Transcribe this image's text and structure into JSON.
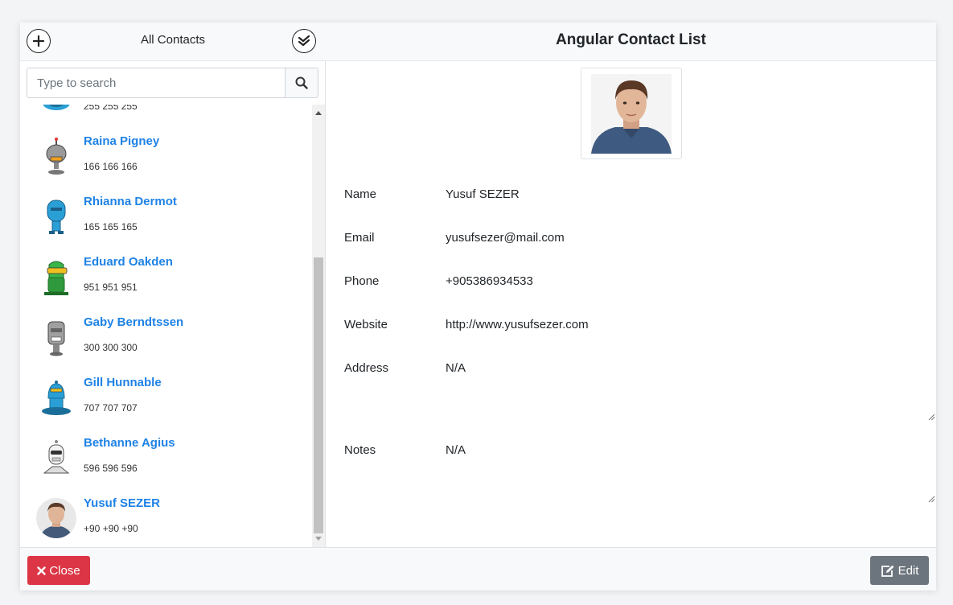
{
  "sidebar": {
    "title": "All Contacts",
    "add_icon": "plus-circle-icon",
    "check_icon": "double-check-icon",
    "search": {
      "placeholder": "Type to search",
      "value": ""
    },
    "contacts": [
      {
        "name": "",
        "phone": "255 255 255",
        "avatar": "robot-blue-round"
      },
      {
        "name": "Raina Pigney",
        "phone": "166 166 166",
        "avatar": "robot-grey-antenna"
      },
      {
        "name": "Rhianna Dermot",
        "phone": "165 165 165",
        "avatar": "robot-blue-tall"
      },
      {
        "name": "Eduard Oakden",
        "phone": "951 951 951",
        "avatar": "robot-green"
      },
      {
        "name": "Gaby Berndtssen",
        "phone": "300 300 300",
        "avatar": "robot-grey-box"
      },
      {
        "name": "Gill Hunnable",
        "phone": "707 707 707",
        "avatar": "robot-blue-dome"
      },
      {
        "name": "Bethanne Agius",
        "phone": "596 596 596",
        "avatar": "robot-white"
      },
      {
        "name": "Yusuf SEZER",
        "phone": "+90 +90 +90",
        "avatar": "person-photo"
      }
    ]
  },
  "detail": {
    "title": "Angular Contact List",
    "fields": {
      "name": {
        "label": "Name",
        "value": "Yusuf SEZER"
      },
      "email": {
        "label": "Email",
        "value": "yusufsezer@mail.com"
      },
      "phone": {
        "label": "Phone",
        "value": "+905386934533"
      },
      "website": {
        "label": "Website",
        "value": "http://www.yusufsezer.com"
      },
      "address": {
        "label": "Address",
        "value": "N/A"
      },
      "notes": {
        "label": "Notes",
        "value": "N/A"
      }
    }
  },
  "footer": {
    "close_label": "Close",
    "edit_label": "Edit"
  },
  "colors": {
    "link": "#1e82e6",
    "danger": "#dc3545",
    "secondary": "#6c757d"
  }
}
